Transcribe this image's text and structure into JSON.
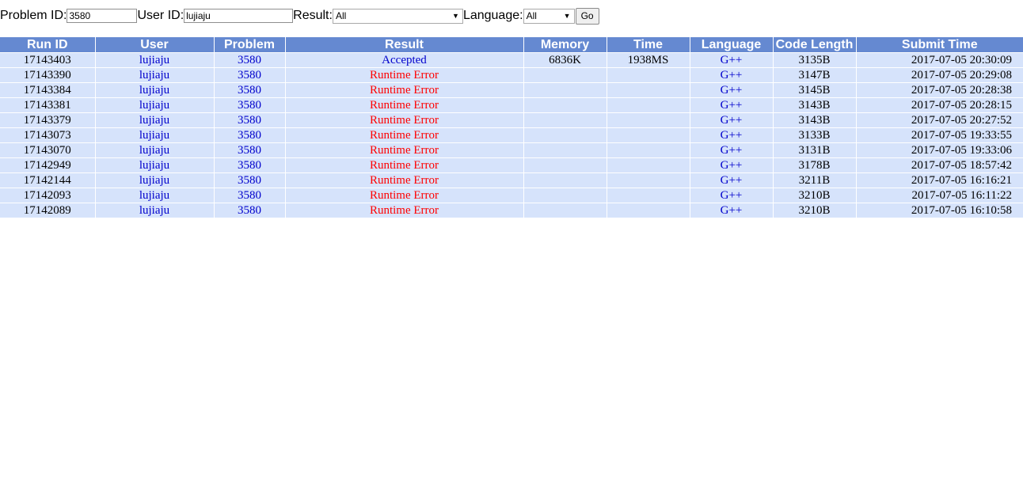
{
  "filter": {
    "problem_label": "Problem ID:",
    "problem_value": "3580",
    "user_label": "User ID:",
    "user_value": "lujiaju",
    "result_label": "Result:",
    "result_value": "All",
    "language_label": "Language:",
    "language_value": "All",
    "go_label": "Go"
  },
  "table": {
    "headers": [
      "Run ID",
      "User",
      "Problem",
      "Result",
      "Memory",
      "Time",
      "Language",
      "Code Length",
      "Submit Time"
    ],
    "rows": [
      {
        "run_id": "17143403",
        "user": "lujiaju",
        "problem": "3580",
        "result": "Accepted",
        "memory": "6836K",
        "time": "1938MS",
        "language": "G++",
        "code_length": "3135B",
        "submit_time": "2017-07-05 20:30:09"
      },
      {
        "run_id": "17143390",
        "user": "lujiaju",
        "problem": "3580",
        "result": "Runtime Error",
        "memory": "",
        "time": "",
        "language": "G++",
        "code_length": "3147B",
        "submit_time": "2017-07-05 20:29:08"
      },
      {
        "run_id": "17143384",
        "user": "lujiaju",
        "problem": "3580",
        "result": "Runtime Error",
        "memory": "",
        "time": "",
        "language": "G++",
        "code_length": "3145B",
        "submit_time": "2017-07-05 20:28:38"
      },
      {
        "run_id": "17143381",
        "user": "lujiaju",
        "problem": "3580",
        "result": "Runtime Error",
        "memory": "",
        "time": "",
        "language": "G++",
        "code_length": "3143B",
        "submit_time": "2017-07-05 20:28:15"
      },
      {
        "run_id": "17143379",
        "user": "lujiaju",
        "problem": "3580",
        "result": "Runtime Error",
        "memory": "",
        "time": "",
        "language": "G++",
        "code_length": "3143B",
        "submit_time": "2017-07-05 20:27:52"
      },
      {
        "run_id": "17143073",
        "user": "lujiaju",
        "problem": "3580",
        "result": "Runtime Error",
        "memory": "",
        "time": "",
        "language": "G++",
        "code_length": "3133B",
        "submit_time": "2017-07-05 19:33:55"
      },
      {
        "run_id": "17143070",
        "user": "lujiaju",
        "problem": "3580",
        "result": "Runtime Error",
        "memory": "",
        "time": "",
        "language": "G++",
        "code_length": "3131B",
        "submit_time": "2017-07-05 19:33:06"
      },
      {
        "run_id": "17142949",
        "user": "lujiaju",
        "problem": "3580",
        "result": "Runtime Error",
        "memory": "",
        "time": "",
        "language": "G++",
        "code_length": "3178B",
        "submit_time": "2017-07-05 18:57:42"
      },
      {
        "run_id": "17142144",
        "user": "lujiaju",
        "problem": "3580",
        "result": "Runtime Error",
        "memory": "",
        "time": "",
        "language": "G++",
        "code_length": "3211B",
        "submit_time": "2017-07-05 16:16:21"
      },
      {
        "run_id": "17142093",
        "user": "lujiaju",
        "problem": "3580",
        "result": "Runtime Error",
        "memory": "",
        "time": "",
        "language": "G++",
        "code_length": "3210B",
        "submit_time": "2017-07-05 16:11:22"
      },
      {
        "run_id": "17142089",
        "user": "lujiaju",
        "problem": "3580",
        "result": "Runtime Error",
        "memory": "",
        "time": "",
        "language": "G++",
        "code_length": "3210B",
        "submit_time": "2017-07-05 16:10:58"
      }
    ]
  },
  "colors": {
    "header_bg": "#6589d1",
    "row_bg": "#d6e3fb",
    "link": "#0000cc",
    "error": "#ff0000"
  }
}
